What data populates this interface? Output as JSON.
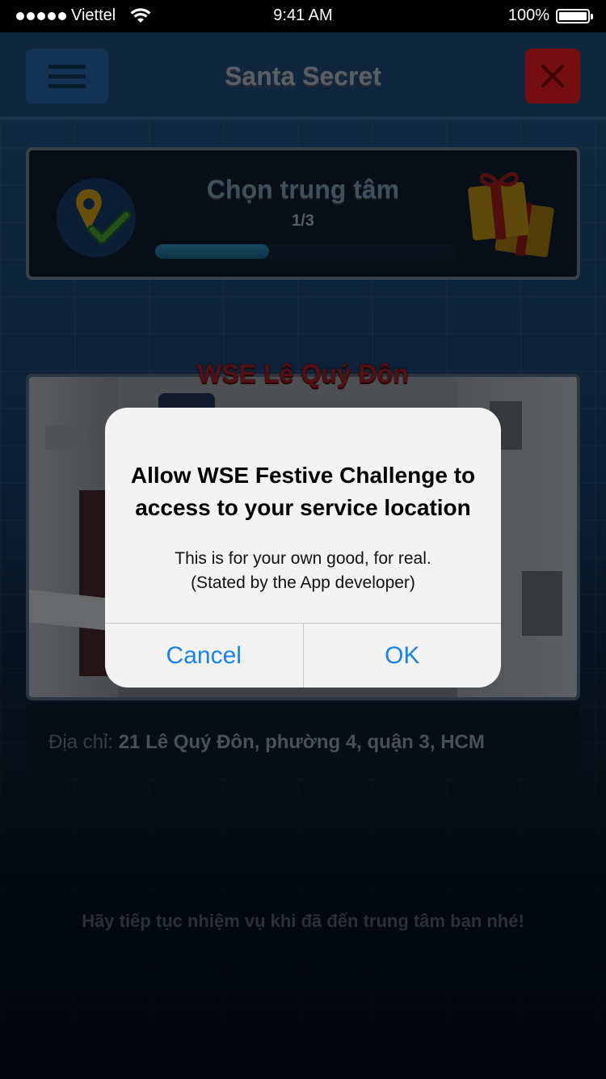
{
  "status_bar": {
    "carrier": "Viettel",
    "time": "9:41 AM",
    "battery": "100%",
    "signal_dots": 5
  },
  "header": {
    "title": "Santa Secret",
    "menu_icon": "hamburger-icon",
    "close_icon": "close-icon"
  },
  "progress_card": {
    "title": "Chọn trung tâm",
    "step": "1/3",
    "progress_fraction": 0.38,
    "left_icon": "location-check-icon",
    "right_icon": "gift-icon"
  },
  "center": {
    "name": "WSE Lê Quý Đôn",
    "address_label": "Địa chỉ: ",
    "address_value": "21 Lê Quý Đôn, phường 4, quận 3, HCM"
  },
  "hint": "Hãy tiếp tục nhiệm vụ khi đã đến trung tâm bạn nhé!",
  "alert": {
    "title_line1": "Allow WSE Festive Challenge to",
    "title_line2": "access to your service location",
    "message_line1": "This is for your own good, for real.",
    "message_line2": "(Stated by the App developer)",
    "cancel_label": "Cancel",
    "ok_label": "OK"
  },
  "colors": {
    "alert_button": "#1a82e8",
    "close_button": "#c7181b",
    "center_name": "#8c1c24"
  }
}
